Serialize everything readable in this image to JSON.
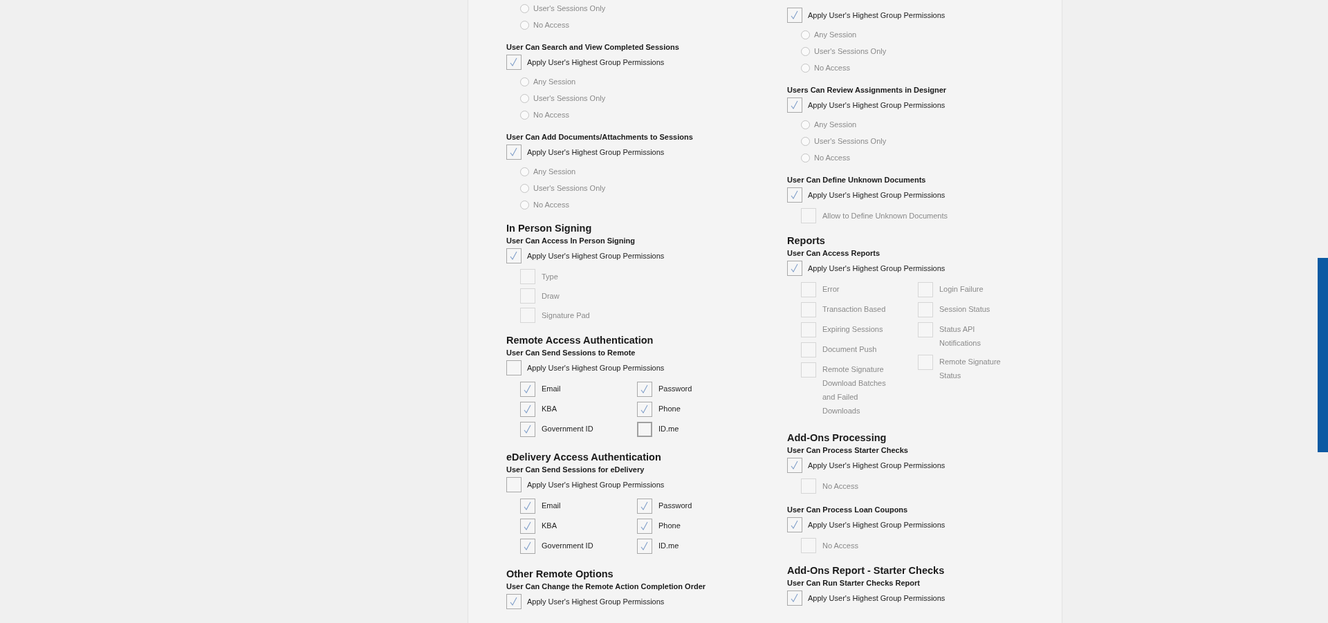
{
  "columns": [
    {
      "blocks": [
        {
          "kind": "group",
          "options": [
            {
              "kind": "radio",
              "label": "User's Sessions Only",
              "selected": false,
              "disabled": true
            },
            {
              "kind": "radio",
              "label": "No Access",
              "selected": false,
              "disabled": true
            }
          ]
        },
        {
          "kind": "group",
          "heading": "User Can Search and View Completed Sessions",
          "apply": {
            "label": "Apply User's Highest Group Permissions",
            "checked": true
          },
          "options": [
            {
              "kind": "radio",
              "label": "Any Session",
              "selected": false,
              "disabled": true
            },
            {
              "kind": "radio",
              "label": "User's Sessions Only",
              "selected": false,
              "disabled": true
            },
            {
              "kind": "radio",
              "label": "No Access",
              "selected": false,
              "disabled": true
            }
          ]
        },
        {
          "kind": "group",
          "heading": "User Can Add Documents/Attachments to Sessions",
          "apply": {
            "label": "Apply User's Highest Group Permissions",
            "checked": true
          },
          "options": [
            {
              "kind": "radio",
              "label": "Any Session",
              "selected": false,
              "disabled": true
            },
            {
              "kind": "radio",
              "label": "User's Sessions Only",
              "selected": false,
              "disabled": true
            },
            {
              "kind": "radio",
              "label": "No Access",
              "selected": false,
              "disabled": true
            }
          ]
        },
        {
          "kind": "title",
          "text": "In Person Signing"
        },
        {
          "kind": "group",
          "heading": "User Can Access In Person Signing",
          "apply": {
            "label": "Apply User's Highest Group Permissions",
            "checked": true
          },
          "options": [
            {
              "kind": "checkbox",
              "label": "Type",
              "checked": false,
              "disabled": true
            },
            {
              "kind": "checkbox",
              "label": "Draw",
              "checked": false,
              "disabled": true
            },
            {
              "kind": "checkbox",
              "label": "Signature Pad",
              "checked": false,
              "disabled": true
            }
          ]
        },
        {
          "kind": "title",
          "text": "Remote Access Authentication"
        },
        {
          "kind": "group",
          "heading": "User Can Send Sessions to Remote",
          "apply": {
            "label": "Apply User's Highest Group Permissions",
            "checked": false
          },
          "grid": [
            [
              {
                "kind": "checkbox",
                "label": "Email",
                "checked": true,
                "disabled": false
              },
              {
                "kind": "checkbox",
                "label": "KBA",
                "checked": true,
                "disabled": false
              },
              {
                "kind": "checkbox",
                "label": "Government ID",
                "checked": true,
                "disabled": false
              }
            ],
            [
              {
                "kind": "checkbox",
                "label": "Password",
                "checked": true,
                "disabled": false
              },
              {
                "kind": "checkbox",
                "label": "Phone",
                "checked": true,
                "disabled": false
              },
              {
                "kind": "checkbox",
                "label": "ID.me",
                "checked": false,
                "disabled": false
              }
            ]
          ]
        },
        {
          "kind": "title",
          "text": "eDelivery Access Authentication"
        },
        {
          "kind": "group",
          "heading": "User Can Send Sessions for eDelivery",
          "apply": {
            "label": "Apply User's Highest Group Permissions",
            "checked": false
          },
          "grid": [
            [
              {
                "kind": "checkbox",
                "label": "Email",
                "checked": true,
                "disabled": false
              },
              {
                "kind": "checkbox",
                "label": "KBA",
                "checked": true,
                "disabled": false
              },
              {
                "kind": "checkbox",
                "label": "Government ID",
                "checked": true,
                "disabled": false
              }
            ],
            [
              {
                "kind": "checkbox",
                "label": "Password",
                "checked": true,
                "disabled": false
              },
              {
                "kind": "checkbox",
                "label": "Phone",
                "checked": true,
                "disabled": false
              },
              {
                "kind": "checkbox",
                "label": "ID.me",
                "checked": true,
                "disabled": false
              }
            ]
          ]
        },
        {
          "kind": "title",
          "text": "Other Remote Options"
        },
        {
          "kind": "group",
          "heading": "User Can Change the Remote Action Completion Order",
          "apply": {
            "label": "Apply User's Highest Group Permissions",
            "checked": true
          }
        }
      ]
    },
    {
      "blocks": [
        {
          "kind": "group",
          "apply": {
            "label": "Apply User's Highest Group Permissions",
            "checked": true
          },
          "options": [
            {
              "kind": "radio",
              "label": "Any Session",
              "selected": false,
              "disabled": true
            },
            {
              "kind": "radio",
              "label": "User's Sessions Only",
              "selected": false,
              "disabled": true
            },
            {
              "kind": "radio",
              "label": "No Access",
              "selected": false,
              "disabled": true
            }
          ]
        },
        {
          "kind": "group",
          "heading": "Users Can Review Assignments in Designer",
          "apply": {
            "label": "Apply User's Highest Group Permissions",
            "checked": true
          },
          "options": [
            {
              "kind": "radio",
              "label": "Any Session",
              "selected": false,
              "disabled": true
            },
            {
              "kind": "radio",
              "label": "User's Sessions Only",
              "selected": false,
              "disabled": true
            },
            {
              "kind": "radio",
              "label": "No Access",
              "selected": false,
              "disabled": true
            }
          ]
        },
        {
          "kind": "group",
          "heading": "User Can Define Unknown Documents",
          "apply": {
            "label": "Apply User's Highest Group Permissions",
            "checked": true
          },
          "options": [
            {
              "kind": "checkbox",
              "label": "Allow to Define Unknown Documents",
              "checked": false,
              "disabled": true
            }
          ]
        },
        {
          "kind": "title",
          "text": "Reports"
        },
        {
          "kind": "group",
          "heading": "User Can Access Reports",
          "apply": {
            "label": "Apply User's Highest Group Permissions",
            "checked": true
          },
          "grid": [
            [
              {
                "kind": "checkbox",
                "label": "Error",
                "checked": false,
                "disabled": true
              },
              {
                "kind": "checkbox",
                "label": "Transaction Based",
                "checked": false,
                "disabled": true
              },
              {
                "kind": "checkbox",
                "label": "Expiring Sessions",
                "checked": false,
                "disabled": true
              },
              {
                "kind": "checkbox",
                "label": "Document Push",
                "checked": false,
                "disabled": true
              },
              {
                "kind": "checkbox",
                "label": "Remote Signature Download Batches and Failed Downloads",
                "checked": false,
                "disabled": true
              }
            ],
            [
              {
                "kind": "checkbox",
                "label": "Login Failure",
                "checked": false,
                "disabled": true
              },
              {
                "kind": "checkbox",
                "label": "Session Status",
                "checked": false,
                "disabled": true
              },
              {
                "kind": "checkbox",
                "label": "Status API Notifications",
                "checked": false,
                "disabled": true
              },
              {
                "kind": "checkbox",
                "label": "Remote Signature Status",
                "checked": false,
                "disabled": true
              }
            ]
          ]
        },
        {
          "kind": "title",
          "text": "Add-Ons Processing"
        },
        {
          "kind": "group",
          "heading": "User Can Process Starter Checks",
          "apply": {
            "label": "Apply User's Highest Group Permissions",
            "checked": true
          },
          "options": [
            {
              "kind": "checkbox",
              "label": "No Access",
              "checked": false,
              "disabled": true
            }
          ]
        },
        {
          "kind": "group",
          "heading": "User Can Process Loan Coupons",
          "apply": {
            "label": "Apply User's Highest Group Permissions",
            "checked": true
          },
          "options": [
            {
              "kind": "checkbox",
              "label": "No Access",
              "checked": false,
              "disabled": true
            }
          ]
        },
        {
          "kind": "title",
          "text": "Add-Ons Report - Starter Checks"
        },
        {
          "kind": "group",
          "heading": "User Can Run Starter Checks Report",
          "apply": {
            "label": "Apply User's Highest Group Permissions",
            "checked": true
          }
        }
      ]
    }
  ]
}
